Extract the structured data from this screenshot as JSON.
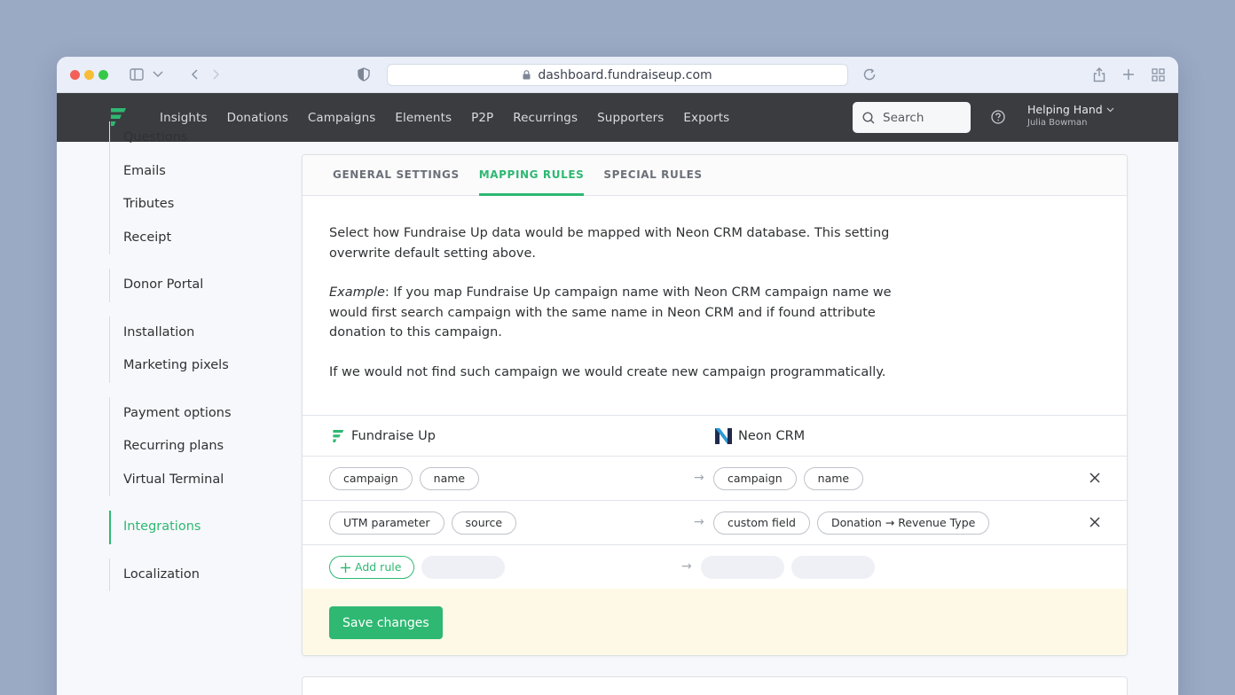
{
  "browser": {
    "url": "dashboard.fundraiseup.com"
  },
  "nav": {
    "items": [
      "Insights",
      "Donations",
      "Campaigns",
      "Elements",
      "P2P",
      "Recurrings",
      "Supporters",
      "Exports"
    ],
    "search_placeholder": "Search",
    "account_name": "Helping Hand",
    "account_user": "Julia Bowman"
  },
  "sidebar": {
    "groups": [
      [
        "Questions",
        "Emails",
        "Tributes",
        "Receipt"
      ],
      [
        "Donor Portal"
      ],
      [
        "Installation",
        "Marketing pixels"
      ],
      [
        "Payment options",
        "Recurring plans",
        "Virtual Terminal"
      ],
      [
        "Integrations"
      ],
      [
        "Localization"
      ]
    ],
    "active": "Integrations"
  },
  "tabs": {
    "general": "GENERAL SETTINGS",
    "mapping": "MAPPING RULES",
    "special": "SPECIAL RULES"
  },
  "description": {
    "p1": "Select how Fundraise Up data would be mapped with Neon CRM database. This setting overwrite default setting above.",
    "example_label": "Example",
    "p2_rest": ": If you map Fundraise Up campaign name with Neon CRM campaign name we would first search campaign with the same name in Neon CRM and if found attribute donation to this campaign.",
    "p3": "If we would not find such campaign we would create new campaign programmatically."
  },
  "mapping": {
    "left_header": "Fundraise Up",
    "right_header": "Neon CRM",
    "rows": [
      {
        "left": [
          "campaign",
          "name"
        ],
        "right": [
          "campaign",
          "name"
        ]
      },
      {
        "left": [
          "UTM parameter",
          "source"
        ],
        "right": [
          "custom field",
          "Donation → Revenue Type"
        ]
      }
    ],
    "add_rule": "Add rule",
    "arrow": "→"
  },
  "save_button": "Save changes",
  "colors": {
    "accent": "#2eb872",
    "nav_bg": "#3a3c40",
    "footer_bg": "#fdf9e6"
  }
}
